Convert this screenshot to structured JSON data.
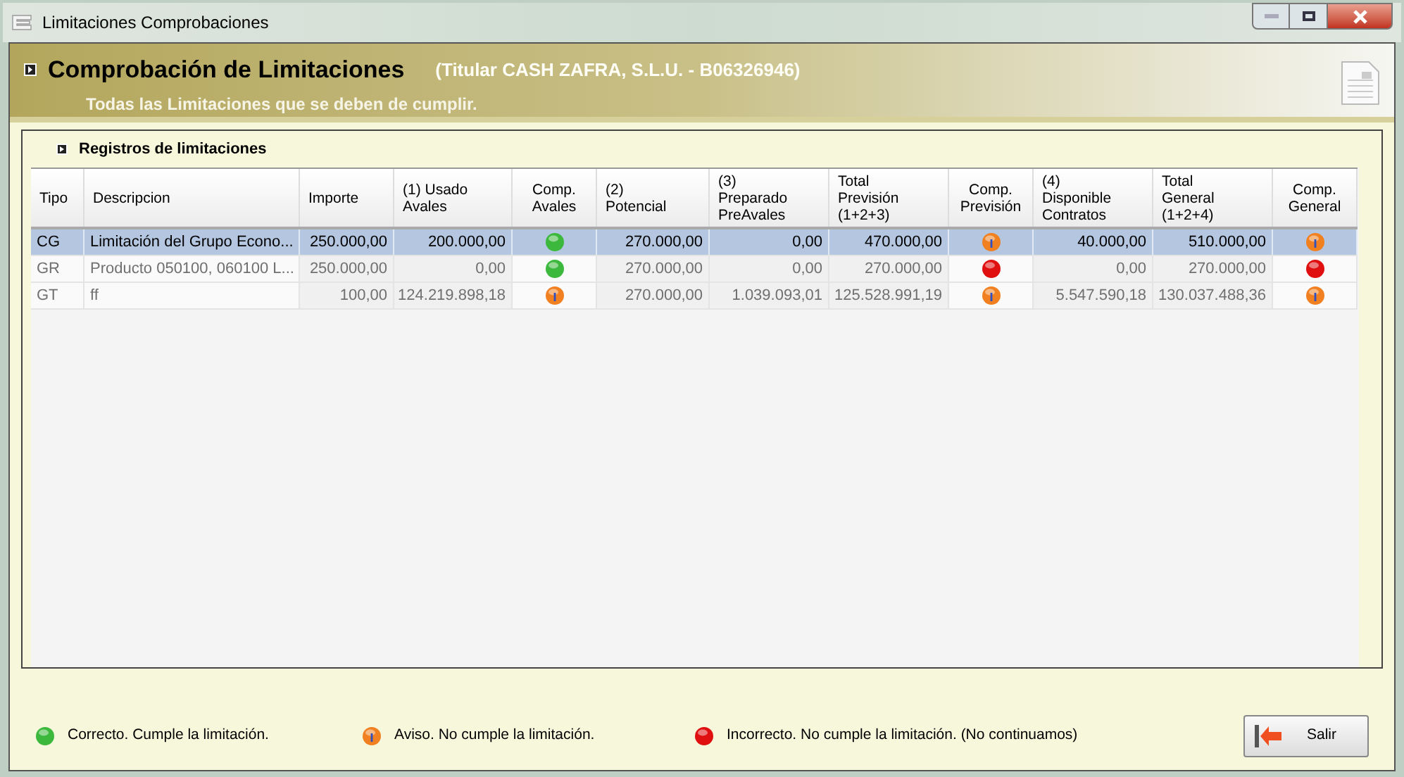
{
  "window": {
    "title": "Limitaciones Comprobaciones"
  },
  "header": {
    "title": "Comprobación de Limitaciones",
    "holder": "(Titular CASH ZAFRA, S.L.U. - B06326946)",
    "subtitle": "Todas las Limitaciones que se deben de cumplir."
  },
  "section": {
    "title": "Registros de limitaciones"
  },
  "table": {
    "columns": [
      "Tipo",
      "Descripcion",
      "Importe",
      "(1) Usado\nAvales",
      "Comp.\nAvales",
      "(2)\nPotencial",
      "(3)\nPreparado\nPreAvales",
      "Total\nPrevisión\n(1+2+3)",
      "Comp.\nPrevisión",
      "(4)\nDisponible\nContratos",
      "Total\nGeneral\n(1+2+4)",
      "Comp.\nGeneral"
    ],
    "rows": [
      {
        "selected": true,
        "cells": [
          {
            "kind": "text",
            "text": "CG"
          },
          {
            "kind": "text",
            "text": "Limitación del Grupo Econo..."
          },
          {
            "kind": "number",
            "text": "250.000,00"
          },
          {
            "kind": "number",
            "text": "200.000,00"
          },
          {
            "kind": "status",
            "color": "#3cb83c"
          },
          {
            "kind": "number",
            "text": "270.000,00"
          },
          {
            "kind": "number",
            "text": "0,00"
          },
          {
            "kind": "number",
            "text": "470.000,00"
          },
          {
            "kind": "status",
            "color": "#f08020"
          },
          {
            "kind": "number",
            "text": "40.000,00"
          },
          {
            "kind": "number",
            "text": "510.000,00"
          },
          {
            "kind": "status",
            "color": "#f08020"
          }
        ]
      },
      {
        "selected": false,
        "cells": [
          {
            "kind": "text",
            "text": "GR"
          },
          {
            "kind": "text",
            "text": "Producto 050100, 060100 L..."
          },
          {
            "kind": "number",
            "text": "250.000,00"
          },
          {
            "kind": "number",
            "text": "0,00"
          },
          {
            "kind": "status",
            "color": "#3cb83c"
          },
          {
            "kind": "number",
            "text": "270.000,00"
          },
          {
            "kind": "number",
            "text": "0,00"
          },
          {
            "kind": "number",
            "text": "270.000,00"
          },
          {
            "kind": "status",
            "color": "#e01010"
          },
          {
            "kind": "number",
            "text": "0,00"
          },
          {
            "kind": "number",
            "text": "270.000,00"
          },
          {
            "kind": "status",
            "color": "#e01010"
          }
        ]
      },
      {
        "selected": false,
        "cells": [
          {
            "kind": "text",
            "text": "GT"
          },
          {
            "kind": "text",
            "text": "ff"
          },
          {
            "kind": "number",
            "text": "100,00"
          },
          {
            "kind": "number",
            "text": "124.219.898,18"
          },
          {
            "kind": "status",
            "color": "#f08020"
          },
          {
            "kind": "number",
            "text": "270.000,00"
          },
          {
            "kind": "number",
            "text": "1.039.093,01"
          },
          {
            "kind": "number",
            "text": "125.528.991,19"
          },
          {
            "kind": "status",
            "color": "#f08020"
          },
          {
            "kind": "number",
            "text": "5.547.590,18"
          },
          {
            "kind": "number",
            "text": "130.037.488,36"
          },
          {
            "kind": "status",
            "color": "#f08020"
          }
        ]
      }
    ]
  },
  "legend": [
    {
      "color": "#3cb83c",
      "text": "Correcto. Cumple la limitación."
    },
    {
      "color": "#f08020",
      "text": "Aviso. No cumple la limitación."
    },
    {
      "color": "#e01010",
      "text": "Incorrecto. No cumple la limitación. (No continuamos)"
    }
  ],
  "buttons": [
    {
      "label": "Salir"
    }
  ]
}
